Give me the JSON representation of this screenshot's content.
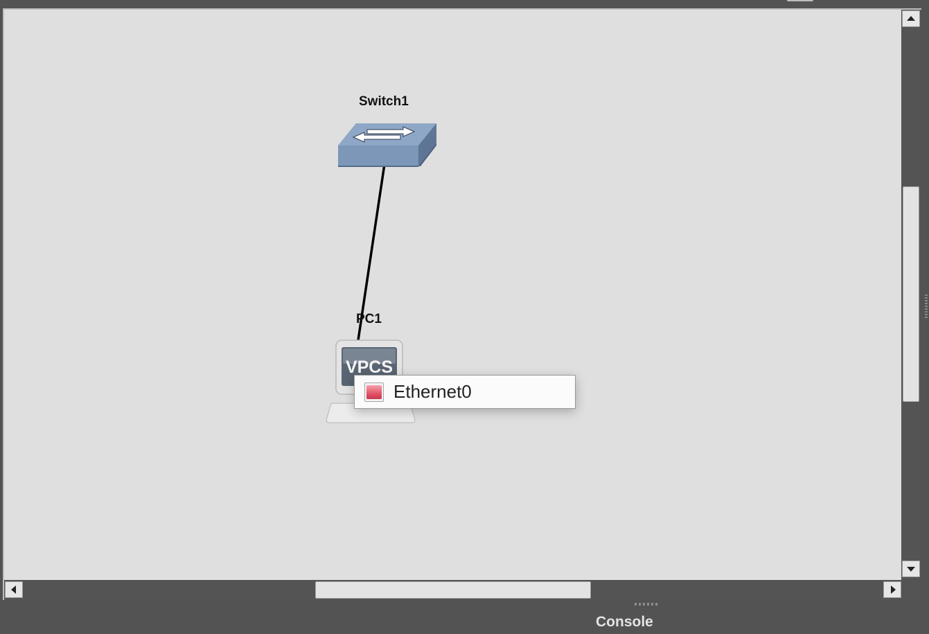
{
  "topology": {
    "nodes": [
      {
        "label": "Switch1",
        "type": "ethernet-switch"
      },
      {
        "label": "PC1",
        "type": "vpcs",
        "icon_text": "VPCS"
      }
    ],
    "link": {
      "from": "Switch1",
      "to": "PC1"
    }
  },
  "port_menu": {
    "items": [
      {
        "label": "Ethernet0",
        "status_color": "#e04e63"
      }
    ]
  },
  "console": {
    "title": "Console"
  },
  "colors": {
    "canvas_bg": "#dfdfdf",
    "chrome_bg": "#535353",
    "switch_blue": "#7c97b8"
  }
}
